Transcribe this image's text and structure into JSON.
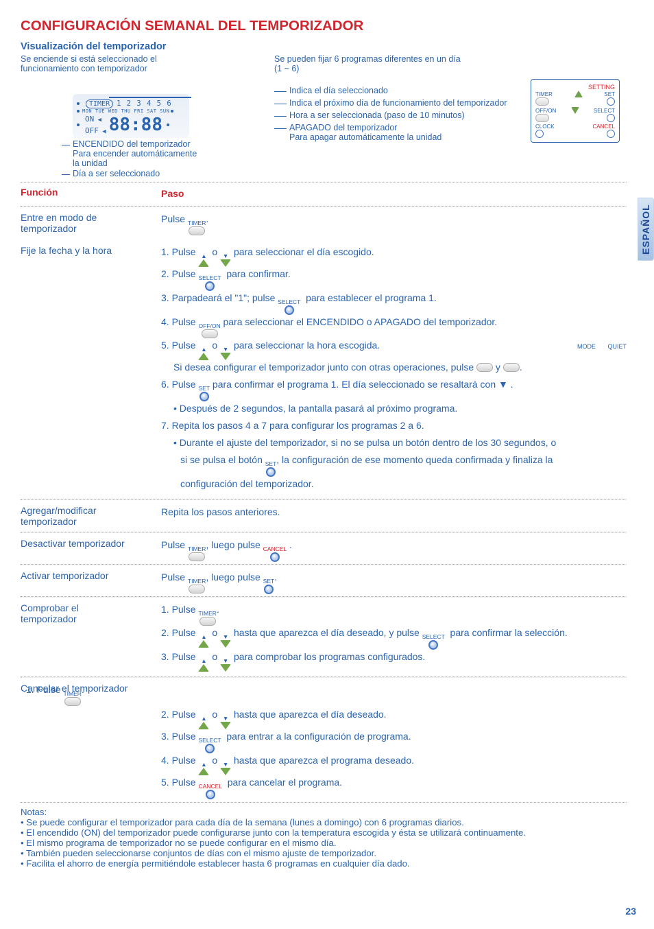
{
  "title": "CONFIGURACIÓN SEMANAL DEL TEMPORIZADOR",
  "lang_tab": "ESPAÑOL",
  "page_number": "23",
  "vis_title": "Visualización del temporizador",
  "diagram": {
    "left_upper1": "Se enciende si está seleccionado el",
    "left_upper2": "funcionamiento con temporizador",
    "timer_pill": "TIMER",
    "prog_numbers": "1 2 3 4 5 6",
    "days": "MON TUE WED THU FRI  SAT SUN",
    "on_label": "ON",
    "off_label": "OFF",
    "big7seg": "88:88",
    "left_callout1": "ENCENDIDO del temporizador",
    "left_callout1b": "Para encender automáticamente",
    "left_callout1c": "la unidad",
    "left_callout2": "Día a ser seleccionado",
    "right_c1a": "Se pueden fijar 6 programas diferentes en un día",
    "right_c1b": "(1 ~ 6)",
    "right_c2": "Indica el día seleccionado",
    "right_c3": "Indica el próximo día de funcionamiento del temporizador",
    "right_c4": "Hora a ser seleccionada (paso de 10 minutos)",
    "right_c5a": "APAGADO del temporizador",
    "right_c5b": "Para apagar automáticamente la unidad",
    "keypad": {
      "setting": "SETTING",
      "timer": "TIMER",
      "set": "SET",
      "off_on": "OFF/ON",
      "select": "SELECT",
      "clock": "CLOCK",
      "cancel": "CANCEL"
    }
  },
  "tbl": {
    "func": "Función",
    "paso": "Paso"
  },
  "rows": {
    "r1": {
      "func1": "Entre en modo de",
      "func2": "temporizador",
      "step": "Pulse ",
      "step_end": "."
    },
    "r2": {
      "func": "Fije la fecha y la hora",
      "s1a": "1. Pulse ",
      "s1b": " o ",
      "s1c": " para seleccionar el día escogido.",
      "s2a": "2. Pulse ",
      "s2b": " para confirmar.",
      "s3a": "3. Parpadeará el \"1\"; pulse ",
      "s3b": " para establecer el programa 1.",
      "s4a": "4. Pulse ",
      "s4b": " para seleccionar el ENCENDIDO o APAGADO del temporizador.",
      "s5a": "5. Pulse ",
      "s5b": " o ",
      "s5c": " para seleccionar la hora escogida.",
      "s5d": "Si desea configurar el temporizador junto con otras operaciones, pulse ",
      "s5e": " y ",
      "s5f": ".",
      "s6a": "6. Pulse ",
      "s6b": " para confirmar el programa 1. El día seleccionado se resaltará con ▼ .",
      "s6c": "Después de 2 segundos, la pantalla pasará al próximo programa.",
      "s7a": "7. Repita los pasos 4 a 7 para configurar los programas 2 a 6.",
      "s7b": "Durante el ajuste del temporizador, si no se pulsa un botón dentro de los 30 segundos, o",
      "s7c": "si se pulsa el botón ",
      "s7d": ", la configuración de ese momento queda confirmada y finaliza la",
      "s7e": "configuración del temporizador."
    },
    "r3": {
      "func1": "Agregar/modificar",
      "func2": "temporizador",
      "step": "Repita los pasos anteriores."
    },
    "r4": {
      "func": "Desactivar temporizador",
      "s1": "Pulse ",
      "s2": ", luego pulse ",
      "s3": " ."
    },
    "r5": {
      "func": "Activar temporizador",
      "s1": "Pulse ",
      "s2": ", luego pulse ",
      "s3": "."
    },
    "r6": {
      "func1": "Comprobar el",
      "func2": "temporizador",
      "s1a": "1. Pulse ",
      "s1b": ".",
      "s2a": "2. Pulse ",
      "s2b": " o ",
      "s2c": " hasta que aparezca el día deseado, y pulse ",
      "s2d": " para confirmar la selección.",
      "s3a": "3. Pulse ",
      "s3b": " o ",
      "s3c": " para comprobar los programas configurados."
    },
    "r7": {
      "func": "Cancelar el temporizador",
      "s1a": "1. Pulse ",
      "s1b": ".",
      "s2a": "2. Pulse ",
      "s2b": " o ",
      "s2c": " hasta que aparezca el día deseado.",
      "s3a": "3. Pulse ",
      "s3b": " para entrar a la configuración de programa.",
      "s4a": "4. Pulse ",
      "s4b": " o ",
      "s4c": " hasta que aparezca el programa deseado.",
      "s5a": "5. Pulse ",
      "s5b": " para cancelar el programa."
    }
  },
  "labels": {
    "TIMER": "TIMER",
    "SELECT": "SELECT",
    "OFF_ON": "OFF/ON",
    "SET": "SET",
    "CANCEL": "CANCEL",
    "MODE": "MODE",
    "QUIET": "QUIET"
  },
  "notes_title": "Notas:",
  "notes": {
    "n1": "Se puede configurar el temporizador para cada día de la semana (lunes a domingo) con 6 programas diarios.",
    "n2": "El encendido (ON) del temporizador puede configurarse junto con la temperatura escogida y ésta se utilizará continuamente.",
    "n3": "El mismo programa de temporizador no se puede configurar en el mismo día.",
    "n4": "También pueden seleccionarse conjuntos de días con el mismo ajuste de temporizador.",
    "n5": "Facilita el ahorro de energía permitiéndole establecer hasta 6 programas en cualquier día dado."
  }
}
